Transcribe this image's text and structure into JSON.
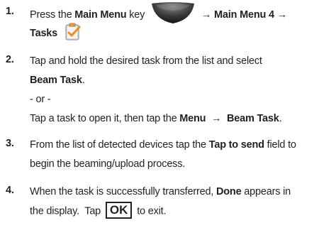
{
  "steps": [
    {
      "number": "1.",
      "press_text": "Press the ",
      "main_menu_key": "Main Menu",
      "key_suffix": " key",
      "arrow1": " → ",
      "main_menu_4": "Main Menu 4",
      "arrow2": " →",
      "tasks": "Tasks",
      "menu_key_icon": "menu-key-icon",
      "tasks_icon": "tasks-clipboard-icon"
    },
    {
      "number": "2.",
      "line1": "Tap and hold the desired task from the list and select",
      "beam_task": "Beam Task",
      "period": ".",
      "or": "- or -",
      "tap_text": "Tap a task to open it, then tap the ",
      "menu": "Menu",
      "arrow": "  →  ",
      "beam_task2": "Beam Task",
      "period2": "."
    },
    {
      "number": "3.",
      "line1_pre": "From the list of detected devices tap the ",
      "tap_to_send": "Tap to send",
      "line1_post": " field to",
      "line2": "begin the beaming/upload process."
    },
    {
      "number": "4.",
      "line1_pre": "When the task is successfully transferred, ",
      "done": "Done",
      "line1_post": " appears in",
      "line2_pre": "the display.  Tap ",
      "ok_label": "OK",
      "line2_post": " to exit."
    }
  ]
}
